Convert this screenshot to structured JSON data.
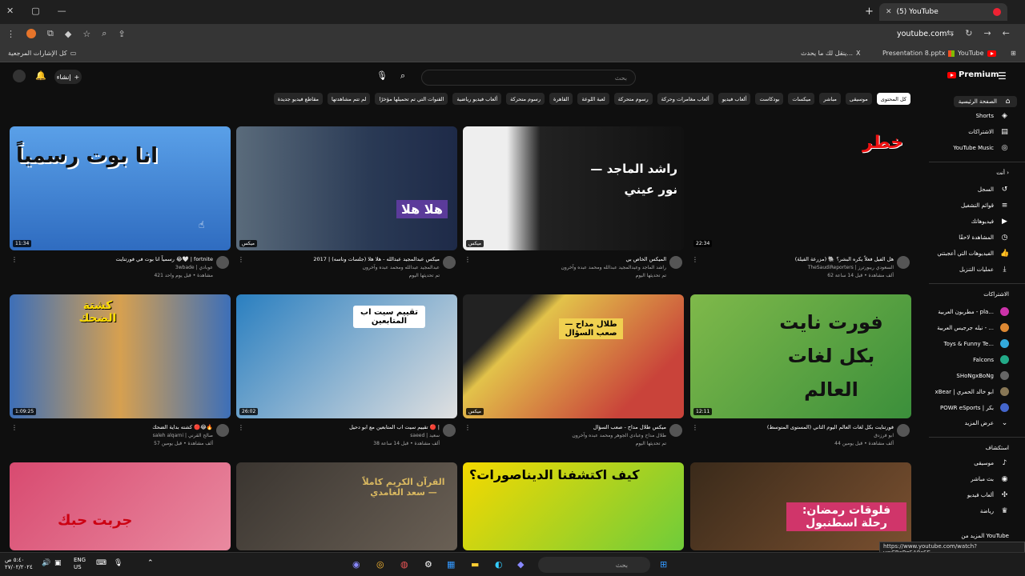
{
  "browser": {
    "tab_title": "(5) YouTube",
    "url": "youtube.com",
    "bookmarks": {
      "all_label": "كل الإشارات المرجعية",
      "items": [
        "YouTube",
        "Presentation 8.pptx",
        "ينقل لك ما يحدث...",
        "X"
      ]
    }
  },
  "masthead": {
    "logo": "Premium",
    "search_placeholder": "بحث",
    "create_label": "إنشاء"
  },
  "chips": [
    "كل المحتوى",
    "موسيقى",
    "مباشر",
    "ميكسات",
    "بودكاست",
    "ألعاب فيديو",
    "ألعاب مغامرات وحركة",
    "رسوم متحركة",
    "لعبة اللوعة",
    "القاهرة",
    "رسوم متحركة",
    "ألعاب فيديو رياضية",
    "القنوات التي تم تحميلها مؤخرًا",
    "لم تتم مشاهدتها",
    "مقاطع فيديو جديدة"
  ],
  "sidebar": {
    "home": "الصفحة الرئيسية",
    "shorts": "Shorts",
    "subscriptions": "الاشتراكات",
    "youtube_music": "YouTube Music",
    "you_label": "أنت",
    "you_items": [
      "السجل",
      "قوائم التشغيل",
      "فيديوهاتك",
      "المشاهدة لاحقًا",
      "الفيديوهات التي أعجبتني",
      "عمليات التنزيل"
    ],
    "subs_head": "الاشتراكات",
    "subs": [
      "مطربون العربية - pla...",
      "نيله جرجيس العربية - ...",
      "Toys & Funny Te...",
      "Falcons",
      "SHoNgxBoNg",
      "xBear | ابو خالد الحمري",
      "POWR eSports | بكر",
      "عرض المزيد"
    ],
    "explore_head": "استكشاف",
    "explore": [
      "موسيقى",
      "بث مباشر",
      "ألعاب فيديو",
      "رياضة"
    ],
    "more_head": "المزيد من YouTube"
  },
  "videos": [
    {
      "title": "هل الفيل فعلاً يكره البشر؟ 🐘 (مزرعة الفيلة)",
      "channel": "TheSaudiReporters | السعودي ريبورترز",
      "meta": "62 ألف مشاهدة • قبل 14 ساعة",
      "duration": "22:34",
      "overlay": "خطر"
    },
    {
      "title": "الميكس الخاص بي",
      "channel": "راشد الماجد وعبدالمجيد عبدالله ومحمد عبده وآخرون",
      "meta": "تم تحديثها اليوم",
      "duration": "ميكس",
      "overlay": "راشد الماجد — نور عيني"
    },
    {
      "title": "ميكس عبدالمجيد عبدالله - هلا هلا (جلسات وناسه) | 2017",
      "channel": "عبدالمجيد عبدالله ومحمد عبده وآخرون",
      "meta": "تم تحديثها اليوم",
      "duration": "ميكس",
      "overlay": "هلا هلا"
    },
    {
      "title": "رسمياً انا بوت في فورتنايت 😂🤍 | fortnite",
      "channel": "3wbade | عوبادي",
      "meta": "421 مشاهدة • قبل يوم واحد",
      "duration": "11:34",
      "overlay": "انا بوت رسمياً"
    },
    {
      "title": "فورتنايت بكل لغات العالم اليوم الثاني (المستوى المتوسط)",
      "channel": "ابو فرزدق",
      "meta": "44 ألف مشاهدة • قبل يومين",
      "duration": "12:11",
      "overlay": "فورت نايت بكل لغات العالم"
    },
    {
      "title": "ميكس طلال مداح - صعب السؤال",
      "channel": "طلال مداح وعبادي الجوهر ومحمد عبده وآخرون",
      "meta": "تم تحديثها اليوم",
      "duration": "ميكس",
      "overlay": "طلال مداح — صعب السؤال"
    },
    {
      "title": "تقييم سيت اب المتابعين مع ابو دحيل 🔴 |",
      "channel": "saeed | سعيد",
      "meta": "38 ألف مشاهدة • قبل 14 ساعة",
      "duration": "26:02",
      "overlay": "تقييم سيت اب المتابعين"
    },
    {
      "title": "كشته بداية الضحك 🔴😂🔥",
      "channel": "saleh alqarni | صالح القرني",
      "meta": "57 ألف مشاهدة • قبل يومين",
      "duration": "1:09:25",
      "overlay": "كشتة الضحك"
    },
    {
      "title": "",
      "channel": "",
      "meta": "",
      "duration": "",
      "overlay": "فلوقات رمضان: رحلة اسطنبول"
    },
    {
      "title": "",
      "channel": "",
      "meta": "",
      "duration": "",
      "overlay": "كيف اكتشفنا الديناصورات؟"
    },
    {
      "title": "",
      "channel": "",
      "meta": "",
      "duration": "",
      "overlay": "القرآن الكريم كاملاً — سعد الغامدي"
    },
    {
      "title": "",
      "channel": "",
      "meta": "",
      "duration": "",
      "overlay": "جربت حبك"
    }
  ],
  "status_url": "https://www.youtube.com/watch?v=CRePqSA8cSE",
  "taskbar": {
    "search": "بحث",
    "lang": "ENG",
    "region": "US",
    "time": "٥:٤٠ ص",
    "date": "٢٧/٠٢/٢٠٢٤"
  },
  "colors": {
    "bg": "#0f0f0f",
    "brand": "#ff0000",
    "chip": "#272727"
  }
}
